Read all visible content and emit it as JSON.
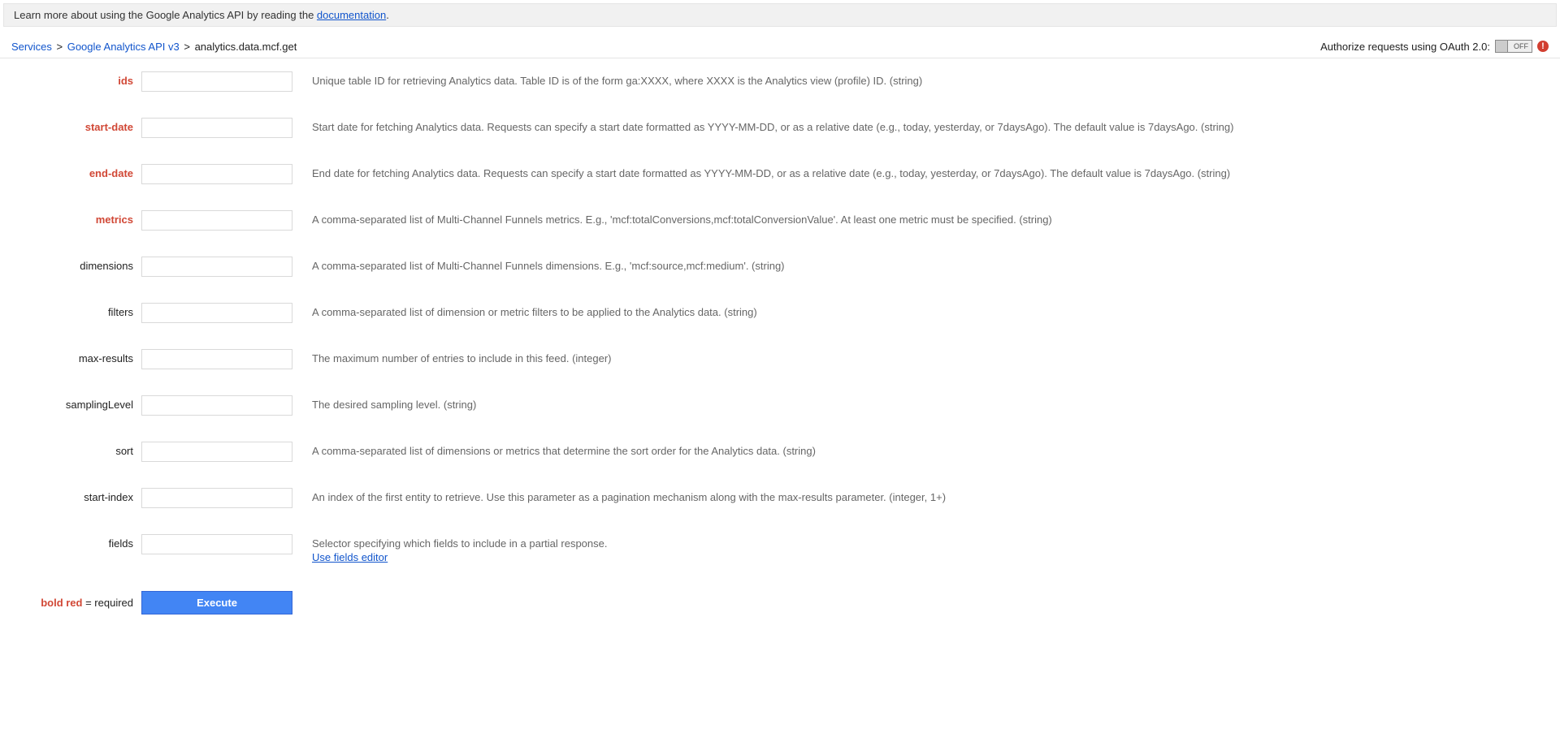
{
  "info_bar": {
    "prefix": "Learn more about using the Google Analytics API by reading the ",
    "link_text": "documentation",
    "suffix": "."
  },
  "breadcrumb": {
    "services": "Services",
    "api": "Google Analytics API v3",
    "current": "analytics.data.mcf.get",
    "sep": ">"
  },
  "auth": {
    "label": "Authorize requests using OAuth 2.0:",
    "toggle_text": "OFF",
    "warn": "!"
  },
  "params": [
    {
      "name": "ids",
      "required": true,
      "desc": "Unique table ID for retrieving Analytics data. Table ID is of the form ga:XXXX, where XXXX is the Analytics view (profile) ID. (string)"
    },
    {
      "name": "start-date",
      "required": true,
      "desc": "Start date for fetching Analytics data. Requests can specify a start date formatted as YYYY-MM-DD, or as a relative date (e.g., today, yesterday, or 7daysAgo). The default value is 7daysAgo. (string)"
    },
    {
      "name": "end-date",
      "required": true,
      "desc": "End date for fetching Analytics data. Requests can specify a start date formatted as YYYY-MM-DD, or as a relative date (e.g., today, yesterday, or 7daysAgo). The default value is 7daysAgo. (string)"
    },
    {
      "name": "metrics",
      "required": true,
      "desc": "A comma-separated list of Multi-Channel Funnels metrics. E.g., 'mcf:totalConversions,mcf:totalConversionValue'. At least one metric must be specified. (string)"
    },
    {
      "name": "dimensions",
      "required": false,
      "desc": "A comma-separated list of Multi-Channel Funnels dimensions. E.g., 'mcf:source,mcf:medium'. (string)"
    },
    {
      "name": "filters",
      "required": false,
      "desc": "A comma-separated list of dimension or metric filters to be applied to the Analytics data. (string)"
    },
    {
      "name": "max-results",
      "required": false,
      "desc": "The maximum number of entries to include in this feed. (integer)"
    },
    {
      "name": "samplingLevel",
      "required": false,
      "desc": "The desired sampling level. (string)"
    },
    {
      "name": "sort",
      "required": false,
      "desc": "A comma-separated list of dimensions or metrics that determine the sort order for the Analytics data. (string)"
    },
    {
      "name": "start-index",
      "required": false,
      "desc": "An index of the first entity to retrieve. Use this parameter as a pagination mechanism along with the max-results parameter. (integer, 1+)"
    },
    {
      "name": "fields",
      "required": false,
      "desc": "Selector specifying which fields to include in a partial response.",
      "link": "Use fields editor"
    }
  ],
  "footer": {
    "bold_red": "bold red",
    "equals_required": " = required",
    "execute": "Execute"
  }
}
